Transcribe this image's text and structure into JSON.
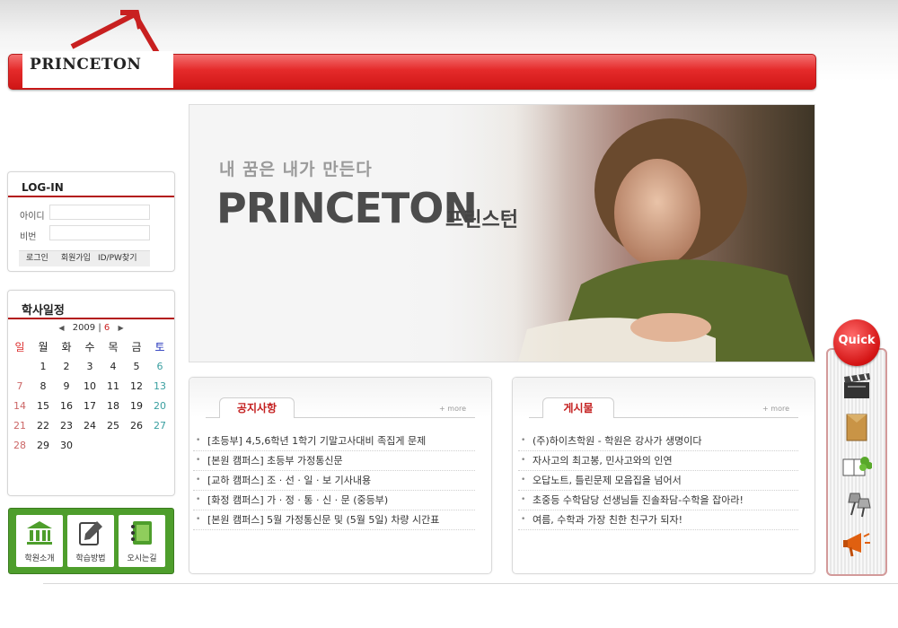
{
  "header": {
    "logo": "PRINCETON"
  },
  "login": {
    "title": "LOG-IN",
    "id_label": "아이디",
    "pw_label": "비번",
    "id_value": "",
    "pw_value": "",
    "buttons": [
      "로그인",
      "회원가입",
      "ID/PW찾기"
    ]
  },
  "schedule": {
    "title": "학사일정",
    "year": "2009",
    "separator": "|",
    "month": "6",
    "weekdays": [
      "일",
      "월",
      "화",
      "수",
      "목",
      "금",
      "토"
    ],
    "weeks": [
      [
        "",
        "1",
        "2",
        "3",
        "4",
        "5",
        "6"
      ],
      [
        "7",
        "8",
        "9",
        "10",
        "11",
        "12",
        "13"
      ],
      [
        "14",
        "15",
        "16",
        "17",
        "18",
        "19",
        "20"
      ],
      [
        "21",
        "22",
        "23",
        "24",
        "25",
        "26",
        "27"
      ],
      [
        "28",
        "29",
        "30",
        "",
        "",
        "",
        ""
      ]
    ]
  },
  "quick_links": [
    "학원소개",
    "학습방법",
    "오시는길"
  ],
  "banner": {
    "subtitle": "내 꿈은 내가 만든다",
    "title": "PRINCETON",
    "title_kor": "프린스턴"
  },
  "notice": {
    "tab": "공지사항",
    "more": "+ more",
    "items": [
      "[초등부] 4,5,6학년 1학기 기말고사대비 족집게 문제",
      "[본원 캠퍼스] 초등부 가정통신문",
      "[교하 캠퍼스] 조 · 선 · 일 · 보 기사내용",
      "[화정 캠퍼스] 가 · 정 · 통 · 신 · 문 (중등부)",
      "[본원 캠퍼스] 5월 가정통신문 및 (5월 5일) 차량 시간표"
    ]
  },
  "board": {
    "tab": "게시물",
    "more": "+ more",
    "items": [
      "(주)하이츠학원 - 학원은 강사가 생명이다",
      "자사고의 최고봉, 민사고와의 인연",
      "오답노트, 틀린문제 모음집을 넘어서",
      "초중등 수학담당 선생님들 진솔좌담-수학을 잡아라!",
      "여름, 수학과 가장 친한 친구가 되자!"
    ]
  },
  "quick": {
    "badge": "Quick",
    "icons": [
      "clapperboard-icon",
      "envelope-icon",
      "book-icon",
      "pushpin-icon",
      "megaphone-icon"
    ]
  },
  "colors": {
    "brand_red": "#d41f1f",
    "accent_green": "#4e9e2c"
  }
}
